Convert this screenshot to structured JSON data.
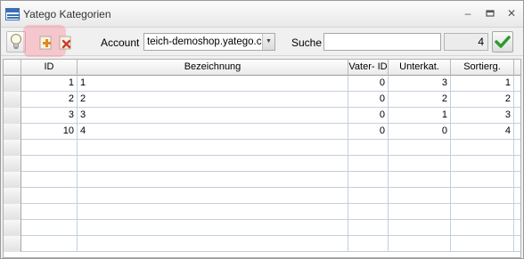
{
  "window": {
    "title": "Yatego Kategorien"
  },
  "toolbar": {
    "account_label": "Account",
    "account_value": "teich-demoshop.yatego.co",
    "search_label": "Suche",
    "search_value": "",
    "count": "4"
  },
  "icons": {
    "app": "table-icon",
    "info": "lightbulb-icon",
    "add": "add-plus-icon",
    "delete": "delete-x-icon",
    "confirm": "checkmark-icon"
  },
  "grid": {
    "columns": [
      "ID",
      "Bezeichnung",
      "Vater- ID",
      "Unterkat.",
      "Sortierg."
    ],
    "rows": [
      {
        "id": "1",
        "name": "1",
        "parent": "0",
        "sub": "3",
        "sort": "1"
      },
      {
        "id": "2",
        "name": "2",
        "parent": "0",
        "sub": "2",
        "sort": "2"
      },
      {
        "id": "3",
        "name": "3",
        "parent": "0",
        "sub": "1",
        "sort": "3"
      },
      {
        "id": "10",
        "name": "4",
        "parent": "0",
        "sub": "0",
        "sort": "4"
      }
    ]
  },
  "colors": {
    "accent": "#3b6fb4",
    "add_green": "#2e9a2e",
    "delete_red": "#d23a2a",
    "highlight": "#ff7890"
  }
}
